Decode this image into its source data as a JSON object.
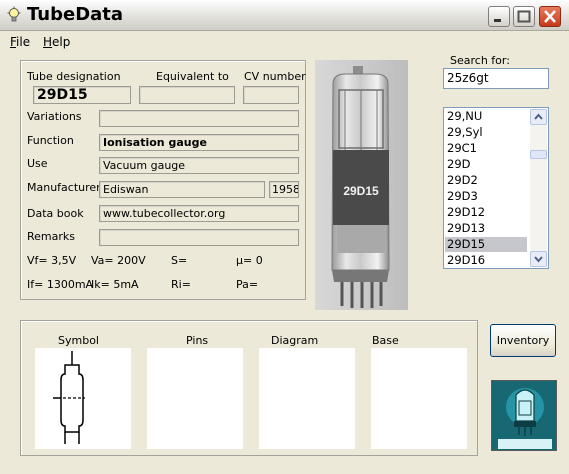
{
  "window": {
    "title": "TubeData"
  },
  "menu": {
    "items": [
      "File",
      "Help"
    ]
  },
  "form": {
    "tube_designation_label": "Tube designation",
    "tube_designation_value": "29D15",
    "equivalent_label": "Equivalent to",
    "equivalent_value": "",
    "cv_label": "CV number",
    "cv_value": "",
    "variations_label": "Variations",
    "variations_value": "",
    "function_label": "Function",
    "function_value": "Ionisation gauge",
    "use_label": "Use",
    "use_value": "Vacuum gauge",
    "manufacturer_label": "Manufacturer",
    "manufacturer_value": "Ediswan",
    "year_value": "1958",
    "data_book_label": "Data book",
    "data_book_value": "www.tubecollector.org",
    "remarks_label": "Remarks",
    "remarks_value": ""
  },
  "specs": {
    "vf": "Vf= 3,5V",
    "va": "Va= 200V",
    "s": "S=",
    "mu": "µ=   0",
    "if": "If= 1300mA",
    "ik": "Ik=  5mA",
    "ri": "Ri=",
    "pa": "Pa="
  },
  "photo": {
    "tube_print": "29D15"
  },
  "search": {
    "label": "Search for:",
    "value": "25z6gt"
  },
  "list": {
    "items": [
      "29,NU",
      "29,Syl",
      "29C1",
      "29D",
      "29D2",
      "29D3",
      "29D12",
      "29D13",
      "29D15",
      "29D16"
    ],
    "selected_index": 8
  },
  "bottom": {
    "symbol_label": "Symbol",
    "pins_label": "Pins",
    "diagram_label": "Diagram",
    "base_label": "Base"
  },
  "buttons": {
    "inventory": "Inventory"
  },
  "icons": {
    "app": "lightbulb-icon",
    "minimize": "minimize-icon",
    "maximize": "maximize-icon",
    "close": "close-icon",
    "scroll_up": "chevron-up-icon",
    "scroll_down": "chevron-down-icon",
    "logo": "tube-logo-icon"
  },
  "colors": {
    "window_bg": "#ece9d8",
    "selection": "#c5c7cd",
    "close_button": "#c4391b"
  }
}
